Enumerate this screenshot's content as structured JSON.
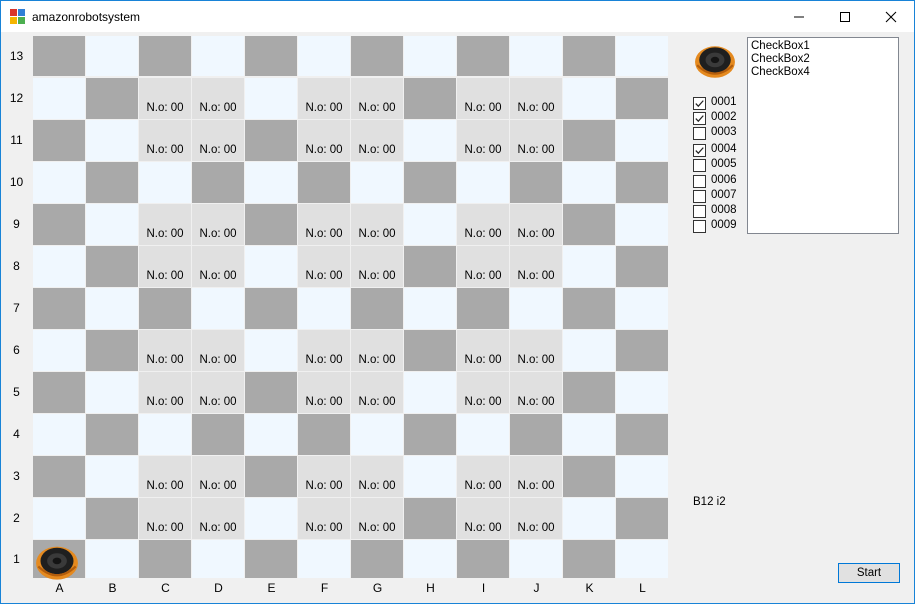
{
  "window": {
    "title": "amazonrobotsystem",
    "icon": "app-window-icon",
    "controls": [
      "minimize-icon",
      "maximize-icon",
      "close-icon"
    ]
  },
  "colors": {
    "dark_cell": "#a9a9a9",
    "light_cell": "#f0f8ff",
    "shelf_cell": "#e0e0e0",
    "robot_orange": "#e58a1f",
    "robot_black": "#1f1f1f"
  },
  "board": {
    "row_labels": [
      "13",
      "12",
      "11",
      "10",
      "9",
      "8",
      "7",
      "6",
      "5",
      "4",
      "3",
      "2",
      "1"
    ],
    "column_labels": [
      "A",
      "B",
      "C",
      "D",
      "E",
      "F",
      "G",
      "H",
      "I",
      "J",
      "K",
      "L"
    ],
    "shelf_label": "N.o: 00",
    "shelf_rows": [
      2,
      3,
      5,
      6,
      8,
      9,
      11,
      12
    ],
    "shelf_columns": [
      "C",
      "D",
      "F",
      "G",
      "I",
      "J"
    ],
    "robots": [
      {
        "column": "A",
        "row": 1,
        "icon": "robot-vacuum-icon"
      }
    ]
  },
  "side_robot": {
    "icon": "robot-vacuum-icon"
  },
  "checkboxes": [
    {
      "label": "0001",
      "checked": true
    },
    {
      "label": "0002",
      "checked": true
    },
    {
      "label": "0003",
      "checked": false
    },
    {
      "label": "0004",
      "checked": true
    },
    {
      "label": "0005",
      "checked": false
    },
    {
      "label": "0006",
      "checked": false
    },
    {
      "label": "0007",
      "checked": false
    },
    {
      "label": "0008",
      "checked": false
    },
    {
      "label": "0009",
      "checked": false
    }
  ],
  "listbox": {
    "items": [
      "CheckBox1",
      "CheckBox2",
      "CheckBox4"
    ]
  },
  "status_text": "B12 i2",
  "start_button": {
    "label": "Start"
  }
}
